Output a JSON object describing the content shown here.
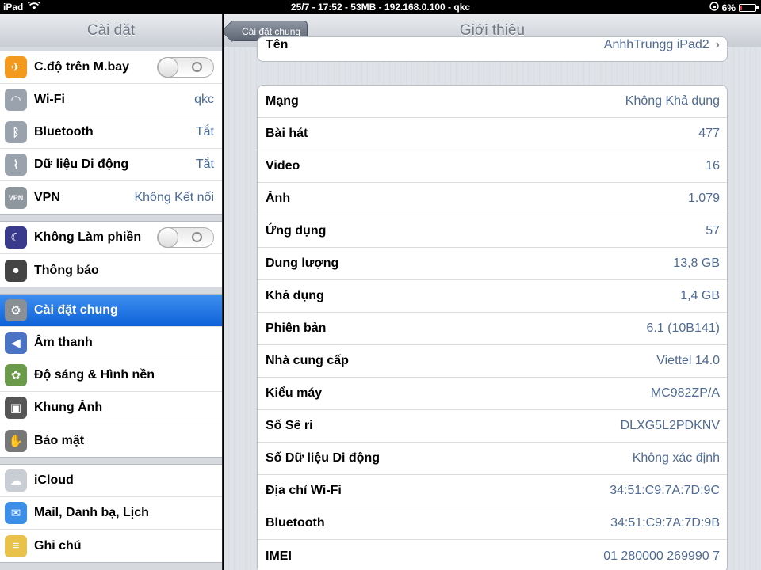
{
  "statusbar": {
    "device": "iPad",
    "center": "25/7 - 17:52 - 53MB - 192.168.0.100 - qkc",
    "battery": "6%",
    "battery_level": 0.06
  },
  "sidebar": {
    "title": "Cài đặt",
    "groups": [
      [
        {
          "label": "C.độ trên M.bay",
          "icon": "airplane-icon",
          "toggle": true
        },
        {
          "label": "Wi-Fi",
          "value": "qkc",
          "icon": "wifi-icon"
        },
        {
          "label": "Bluetooth",
          "value": "Tắt",
          "icon": "bluetooth-icon"
        },
        {
          "label": "Dữ liệu Di động",
          "value": "Tắt",
          "icon": "cellular-icon"
        },
        {
          "label": "VPN",
          "value": "Không Kết nối",
          "icon": "vpn-icon"
        }
      ],
      [
        {
          "label": "Không Làm phiền",
          "icon": "moon-icon",
          "toggle": true
        },
        {
          "label": "Thông báo",
          "icon": "notification-icon"
        }
      ],
      [
        {
          "label": "Cài đặt chung",
          "icon": "gear-icon",
          "selected": true
        },
        {
          "label": "Âm thanh",
          "icon": "speaker-icon"
        },
        {
          "label": "Độ sáng & Hình nền",
          "icon": "flower-icon"
        },
        {
          "label": "Khung Ảnh",
          "icon": "picture-frame-icon"
        },
        {
          "label": "Bảo mật",
          "icon": "hand-icon"
        }
      ],
      [
        {
          "label": "iCloud",
          "icon": "cloud-icon"
        },
        {
          "label": "Mail, Danh bạ, Lịch",
          "icon": "mail-icon"
        },
        {
          "label": "Ghi chú",
          "icon": "notes-icon"
        }
      ]
    ]
  },
  "main": {
    "title": "Giới thiệu",
    "back_label": "Cài đặt chung",
    "name_row": {
      "key": "Tên",
      "value": "AnhhTrungg iPad2"
    },
    "rows": [
      {
        "key": "Mạng",
        "value": "Không Khả dụng"
      },
      {
        "key": "Bài hát",
        "value": "477"
      },
      {
        "key": "Video",
        "value": "16"
      },
      {
        "key": "Ảnh",
        "value": "1.079"
      },
      {
        "key": "Ứng dụng",
        "value": "57"
      },
      {
        "key": "Dung lượng",
        "value": "13,8 GB"
      },
      {
        "key": "Khả dụng",
        "value": "1,4 GB"
      },
      {
        "key": "Phiên bản",
        "value": "6.1 (10B141)"
      },
      {
        "key": "Nhà cung cấp",
        "value": "Viettel 14.0"
      },
      {
        "key": "Kiểu máy",
        "value": "MC982ZP/A"
      },
      {
        "key": "Số Sê ri",
        "value": "DLXG5L2PDKNV"
      },
      {
        "key": "Số Dữ liệu Di động",
        "value": "Không xác định"
      },
      {
        "key": "Địa chỉ Wi-Fi",
        "value": "34:51:C9:7A:7D:9C"
      },
      {
        "key": "Bluetooth",
        "value": "34:51:C9:7A:7D:9B"
      },
      {
        "key": "IMEI",
        "value": "01 280000 269990 7"
      }
    ]
  },
  "colors": {
    "accent": "#1a6fe0",
    "value_text": "#4f6a93"
  }
}
